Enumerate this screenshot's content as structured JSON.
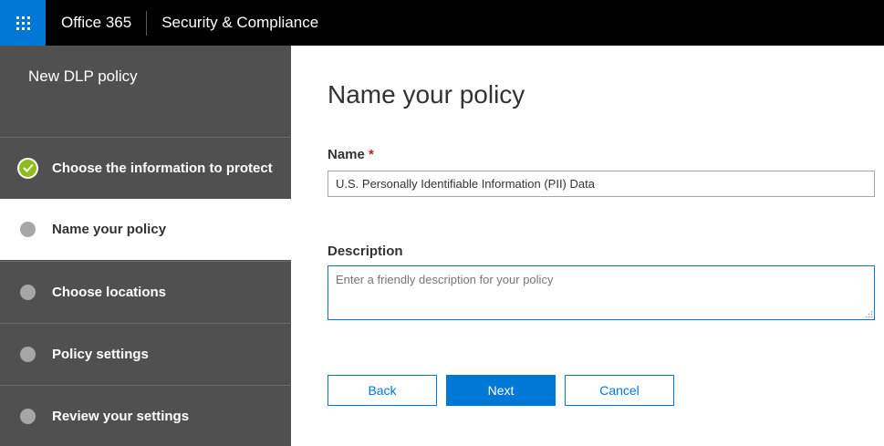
{
  "header": {
    "brand": "Office 365",
    "app_title": "Security & Compliance",
    "app_launcher_icon": "waffle-icon",
    "accent_color": "#0078d7"
  },
  "sidebar": {
    "title": "New DLP policy",
    "steps": [
      {
        "label": "Choose the information to protect",
        "state": "completed",
        "icon": "check-icon"
      },
      {
        "label": "Name your policy",
        "state": "current"
      },
      {
        "label": "Choose locations",
        "state": "pending"
      },
      {
        "label": "Policy settings",
        "state": "pending"
      },
      {
        "label": "Review your settings",
        "state": "pending"
      }
    ]
  },
  "main": {
    "title": "Name your policy",
    "name_field": {
      "label": "Name",
      "required_mark": "*",
      "value": "U.S. Personally Identifiable Information (PII) Data"
    },
    "description_field": {
      "label": "Description",
      "value": "",
      "placeholder": "Enter a friendly description for your policy"
    },
    "buttons": {
      "back": "Back",
      "next": "Next",
      "cancel": "Cancel"
    }
  }
}
